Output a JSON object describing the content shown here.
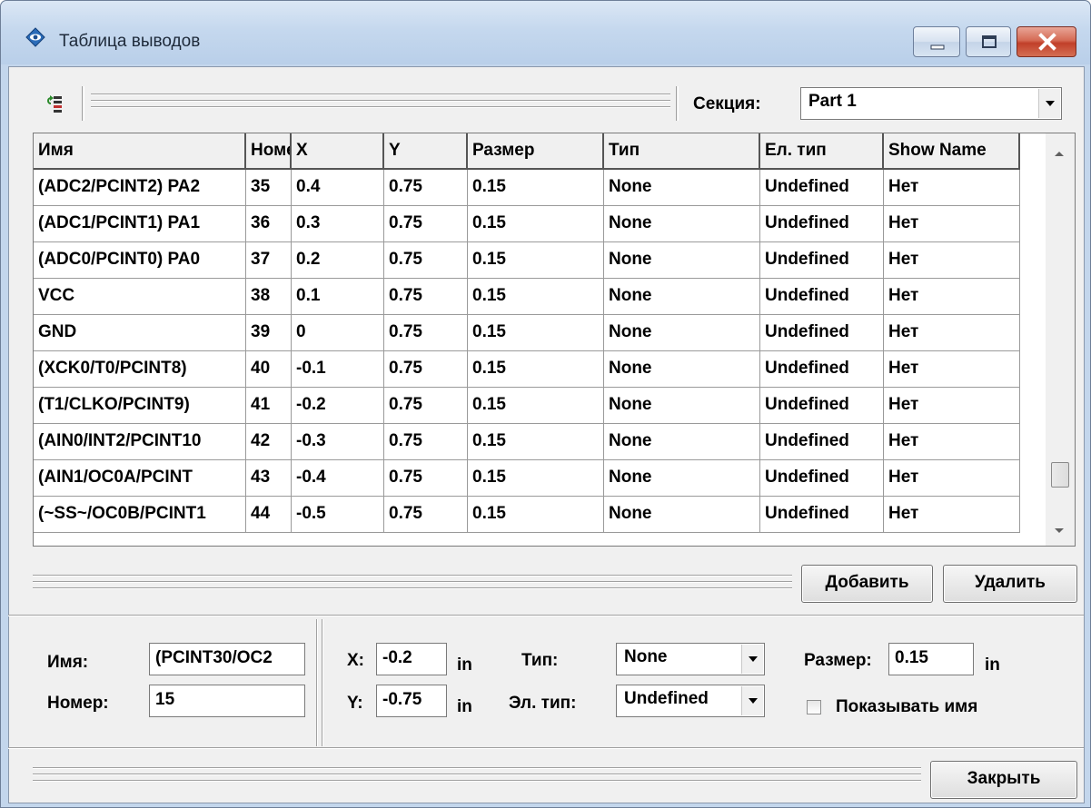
{
  "window": {
    "title": "Таблица выводов"
  },
  "toolbar": {
    "section_label": "Секция:",
    "section_value": "Part 1"
  },
  "grid": {
    "columns": [
      "Имя",
      "Номер",
      "X",
      "Y",
      "Размер",
      "Тип",
      "Ел. тип",
      "Show Name"
    ],
    "rows": [
      [
        "(ADC2/PCINT2) PA2",
        "35",
        "0.4",
        "0.75",
        "0.15",
        "None",
        "Undefined",
        "Нет"
      ],
      [
        "(ADC1/PCINT1) PA1",
        "36",
        "0.3",
        "0.75",
        "0.15",
        "None",
        "Undefined",
        "Нет"
      ],
      [
        "(ADC0/PCINT0) PA0",
        "37",
        "0.2",
        "0.75",
        "0.15",
        "None",
        "Undefined",
        "Нет"
      ],
      [
        "VCC",
        "38",
        "0.1",
        "0.75",
        "0.15",
        "None",
        "Undefined",
        "Нет"
      ],
      [
        "GND",
        "39",
        "0",
        "0.75",
        "0.15",
        "None",
        "Undefined",
        "Нет"
      ],
      [
        "(XCK0/T0/PCINT8)",
        "40",
        "-0.1",
        "0.75",
        "0.15",
        "None",
        "Undefined",
        "Нет"
      ],
      [
        "(T1/CLKO/PCINT9)",
        "41",
        "-0.2",
        "0.75",
        "0.15",
        "None",
        "Undefined",
        "Нет"
      ],
      [
        "(AIN0/INT2/PCINT10",
        "42",
        "-0.3",
        "0.75",
        "0.15",
        "None",
        "Undefined",
        "Нет"
      ],
      [
        "(AIN1/OC0A/PCINT",
        "43",
        "-0.4",
        "0.75",
        "0.15",
        "None",
        "Undefined",
        "Нет"
      ],
      [
        "(~SS~/OC0B/PCINT1",
        "44",
        "-0.5",
        "0.75",
        "0.15",
        "None",
        "Undefined",
        "Нет"
      ]
    ]
  },
  "actions": {
    "add_label": "Добавить",
    "delete_label": "Удалить",
    "close_label": "Закрыть"
  },
  "editor": {
    "name_label": "Имя:",
    "name_value": "(PCINT30/OC2",
    "number_label": "Номер:",
    "number_value": "15",
    "x_label": "X:",
    "x_value": "-0.2",
    "y_label": "Y:",
    "y_value": "-0.75",
    "unit": "in",
    "type_label": "Тип:",
    "type_value": "None",
    "eltype_label": "Эл. тип:",
    "eltype_value": "Undefined",
    "size_label": "Размер:",
    "size_value": "0.15",
    "show_name_label": "Показывать имя"
  }
}
